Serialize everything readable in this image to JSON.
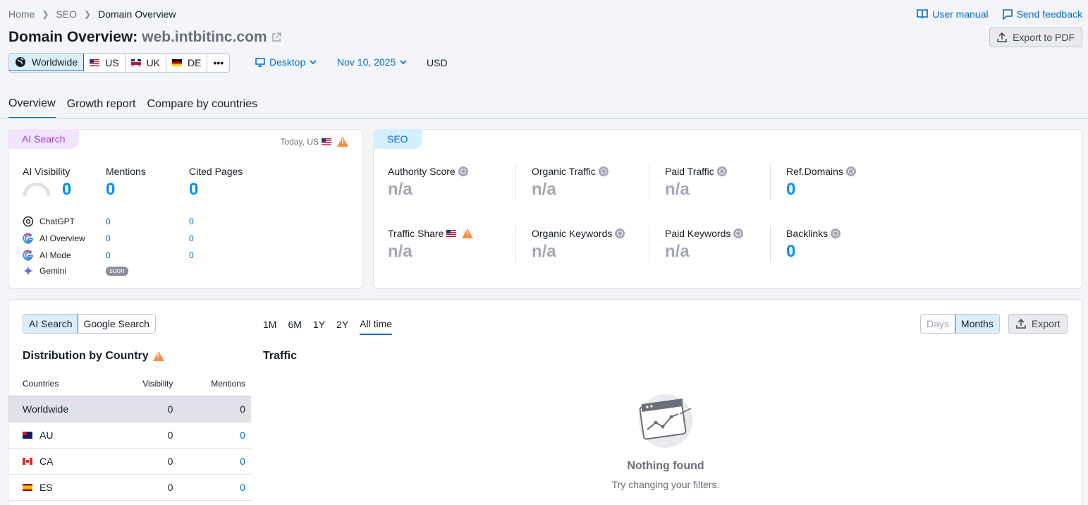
{
  "breadcrumb": [
    "Home",
    "SEO",
    "Domain Overview"
  ],
  "top_links": {
    "manual": "User manual",
    "feedback": "Send feedback"
  },
  "title": {
    "prefix": "Domain Overview:",
    "domain": "web.intbitinc.com"
  },
  "export_pdf": "Export to PDF",
  "databases": {
    "worldwide": "Worldwide",
    "us": "US",
    "uk": "UK",
    "de": "DE",
    "more": "•••"
  },
  "device": "Desktop",
  "date": "Nov 10, 2025",
  "currency": "USD",
  "tabs": [
    "Overview",
    "Growth report",
    "Compare by countries"
  ],
  "ai_card": {
    "badge": "AI Search",
    "context": "Today, US",
    "metrics": [
      {
        "label": "AI Visibility",
        "value": "0"
      },
      {
        "label": "Mentions",
        "value": "0"
      },
      {
        "label": "Cited Pages",
        "value": "0"
      }
    ],
    "sources": [
      {
        "name": "ChatGPT",
        "mentions": "0",
        "cited": "0"
      },
      {
        "name": "AI Overview",
        "mentions": "0",
        "cited": "0"
      },
      {
        "name": "AI Mode",
        "mentions": "0",
        "cited": "0"
      },
      {
        "name": "Gemini",
        "soon": "soon"
      }
    ]
  },
  "seo_card": {
    "badge": "SEO",
    "metrics": [
      {
        "label": "Authority Score",
        "value": "n/a"
      },
      {
        "label": "Organic Traffic",
        "value": "n/a"
      },
      {
        "label": "Paid Traffic",
        "value": "n/a"
      },
      {
        "label": "Ref.Domains",
        "value": "0"
      },
      {
        "label": "Traffic Share",
        "value": "n/a"
      },
      {
        "label": "Organic Keywords",
        "value": "n/a"
      },
      {
        "label": "Paid Keywords",
        "value": "n/a"
      },
      {
        "label": "Backlinks",
        "value": "0"
      }
    ]
  },
  "bottom": {
    "search_toggle": [
      "AI Search",
      "Google Search"
    ],
    "periods": [
      "1M",
      "6M",
      "1Y",
      "2Y",
      "All time"
    ],
    "granularity": [
      "Days",
      "Months"
    ],
    "export": "Export",
    "dist_title": "Distribution by Country",
    "traffic_title": "Traffic",
    "columns": [
      "Countries",
      "Visibility",
      "Mentions"
    ],
    "rows": [
      {
        "country": "Worldwide",
        "visibility": "0",
        "mentions": "0"
      },
      {
        "country": "AU",
        "visibility": "0",
        "mentions": "0"
      },
      {
        "country": "CA",
        "visibility": "0",
        "mentions": "0"
      },
      {
        "country": "ES",
        "visibility": "0",
        "mentions": "0"
      }
    ],
    "empty_title": "Nothing found",
    "empty_sub": "Try changing your filters."
  }
}
